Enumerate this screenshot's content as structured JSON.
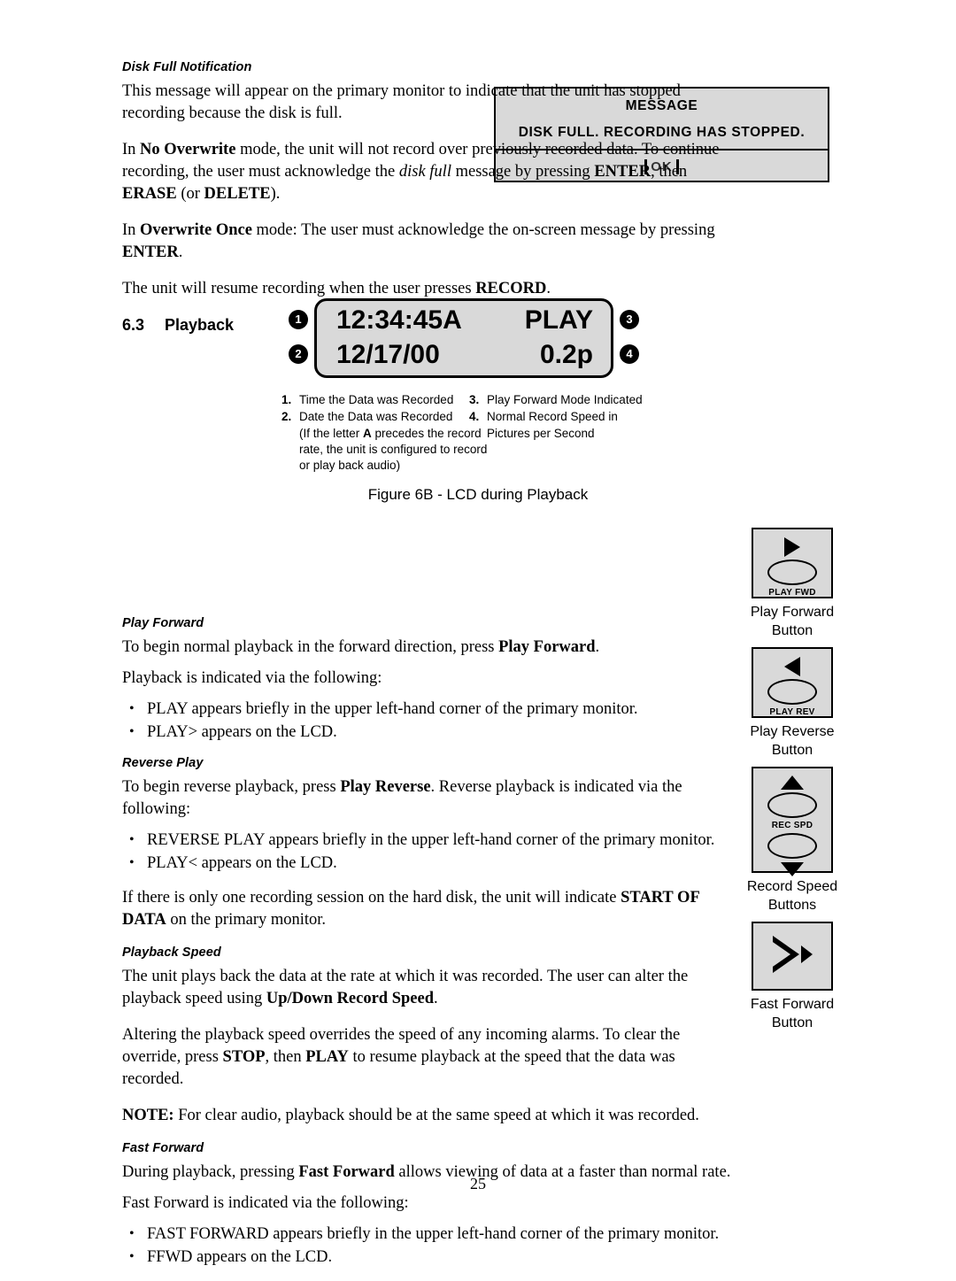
{
  "page": {
    "number": "25"
  },
  "disk_full": {
    "heading": "Disk Full Notification",
    "p1": "This message will appear on the primary monitor to indicate that the unit has stopped recording because the disk is full.",
    "p2_parts": {
      "a": "In ",
      "b": "No Overwrite",
      "c": " mode, the unit will not record over previously recorded data. To continue recording, the user must acknowledge the ",
      "d": "disk full",
      "e": " message by pressing ",
      "f": "ENTER",
      "g": ", then ",
      "h": "ERASE",
      "i": " (or ",
      "j": "DELETE",
      "k": ")."
    },
    "p3_parts": {
      "a": "In ",
      "b": "Overwrite Once",
      "c": " mode: The user must acknowledge the on-screen message by pressing ",
      "d": "ENTER",
      "e": "."
    },
    "p4_parts": {
      "a": "The unit will resume recording when the user presses ",
      "b": "RECORD",
      "c": "."
    }
  },
  "message_box": {
    "title": "MESSAGE",
    "text": "DISK FULL. RECORDING HAS STOPPED.",
    "ok_label": "OK"
  },
  "section": {
    "number": "6.3",
    "title": "Playback"
  },
  "lcd": {
    "time": "12:34:45A",
    "mode": "PLAY",
    "date": "12/17/00",
    "speed": "0.2p",
    "callouts": [
      "1",
      "2",
      "3",
      "4"
    ],
    "legend_left": [
      {
        "n": "1.",
        "text": "Time the Data was Recorded"
      },
      {
        "n": "2.",
        "text": "Date the Data was Recorded"
      }
    ],
    "legend_left_cont_parts": {
      "a": "(If the letter ",
      "b": "A",
      "c": " precedes the record rate, the unit is configured to record or play back audio)"
    },
    "legend_right": [
      {
        "n": "3.",
        "text": "Play Forward Mode Indicated"
      },
      {
        "n": "4.",
        "text": "Normal Record Speed in"
      }
    ],
    "legend_right_cont": "Pictures per Second",
    "caption": "Figure 6B - LCD during Playback"
  },
  "play_forward": {
    "heading": "Play Forward",
    "p1_parts": {
      "a": "To begin normal playback in the forward direction, press ",
      "b": "Play Forward",
      "c": "."
    },
    "p2": "Playback is indicated via the following:",
    "bullets": [
      "PLAY appears briefly in the upper left-hand corner of the primary monitor.",
      "PLAY> appears on the LCD."
    ]
  },
  "reverse_play": {
    "heading": "Reverse Play",
    "p1_parts": {
      "a": "To begin reverse playback, press ",
      "b": "Play Reverse",
      "c": ". Reverse playback is indicated via the following:"
    },
    "bullets": [
      "REVERSE PLAY appears briefly in the upper left-hand corner of the primary monitor.",
      "PLAY< appears on the LCD."
    ],
    "p2_parts": {
      "a": "If there is only one recording session on the hard disk, the unit will indicate ",
      "b": "START OF DATA",
      "c": " on the primary monitor."
    }
  },
  "playback_speed": {
    "heading": "Playback Speed",
    "p1_parts": {
      "a": "The unit plays back the data at the rate at which it was recorded. The user can alter the playback speed using ",
      "b": "Up/Down Record Speed",
      "c": "."
    },
    "p2_parts": {
      "a": "Altering the playback speed overrides the speed of any incoming alarms. To clear the override, press ",
      "b": "STOP",
      "c": ", then ",
      "d": "PLAY",
      "e": " to resume playback at the speed that the data was recorded."
    },
    "note_parts": {
      "a": "NOTE:",
      "b": " For clear audio, playback should be at the same speed at which it was recorded."
    }
  },
  "fast_forward": {
    "heading": "Fast Forward",
    "p1_parts": {
      "a": "During playback, pressing ",
      "b": "Fast Forward",
      "c": " allows viewing of data at a faster than normal rate."
    },
    "p2": "Fast Forward is indicated via the following:",
    "bullets": [
      "FAST FORWARD appears briefly in the upper left-hand corner of the primary monitor.",
      "FFWD appears on the LCD."
    ]
  },
  "buttons": [
    {
      "key_label": "PLAY FWD",
      "caption_l1": "Play Forward",
      "caption_l2": "Button"
    },
    {
      "key_label": "PLAY REV",
      "caption_l1": "Play Reverse",
      "caption_l2": "Button"
    },
    {
      "key_label": "REC SPD",
      "caption_l1": "Record Speed",
      "caption_l2": "Buttons"
    },
    {
      "key_label": "",
      "caption_l1": "Fast Forward",
      "caption_l2": "Button"
    }
  ]
}
